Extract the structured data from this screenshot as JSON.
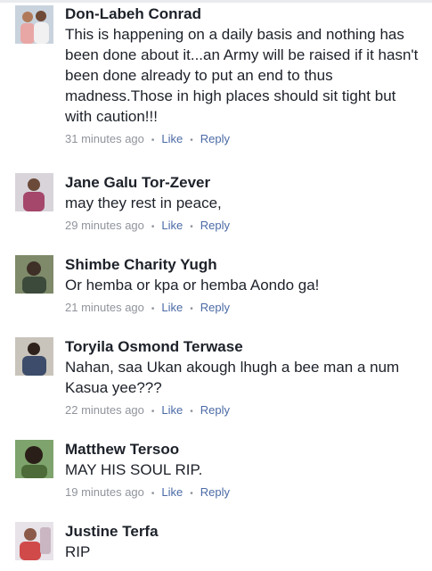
{
  "comments": [
    {
      "author": "Don-Labeh Conrad",
      "text": "This is happening on a daily basis and nothing has been done about it...an Army will be raised if it hasn't been done already to put an end to thus madness.Those in high places should sit tight but with caution!!!",
      "time": "31 minutes ago",
      "like": "Like",
      "reply": "Reply",
      "avatar_colors": {
        "bg": "#c9d3dd",
        "accent": "#b07a5a",
        "shirt": "#e8a7a5"
      }
    },
    {
      "author": "Jane Galu Tor-Zever",
      "text": "may they rest in peace,",
      "time": "29 minutes ago",
      "like": "Like",
      "reply": "Reply",
      "avatar_colors": {
        "bg": "#d8d4da",
        "accent": "#6b4a3a",
        "shirt": "#a5476a"
      }
    },
    {
      "author": "Shimbe Charity Yugh",
      "text": "Or hemba or kpa or hemba Aondo ga!",
      "time": "21 minutes ago",
      "like": "Like",
      "reply": "Reply",
      "avatar_colors": {
        "bg": "#7e8a6a",
        "accent": "#3e2f27",
        "shirt": "#3b4a3a"
      }
    },
    {
      "author": "Toryila Osmond Terwase",
      "text": "Nahan, saa Ukan akough lhugh a bee man a num Kasua yee???",
      "time": "22 minutes ago",
      "like": "Like",
      "reply": "Reply",
      "avatar_colors": {
        "bg": "#c9c4bb",
        "accent": "#2f221c",
        "shirt": "#3c4c6a"
      }
    },
    {
      "author": "Matthew Tersoo",
      "text": "MAY HIS SOUL RIP.",
      "time": "19 minutes ago",
      "like": "Like",
      "reply": "Reply",
      "avatar_colors": {
        "bg": "#7ea36c",
        "accent": "#2a1e18",
        "shirt": "#4c6b38"
      }
    },
    {
      "author": "Justine Terfa",
      "text": "RIP",
      "avatar_colors": {
        "bg": "#e7e3e8",
        "accent": "#8b5a48",
        "shirt": "#d04a4a"
      }
    }
  ]
}
